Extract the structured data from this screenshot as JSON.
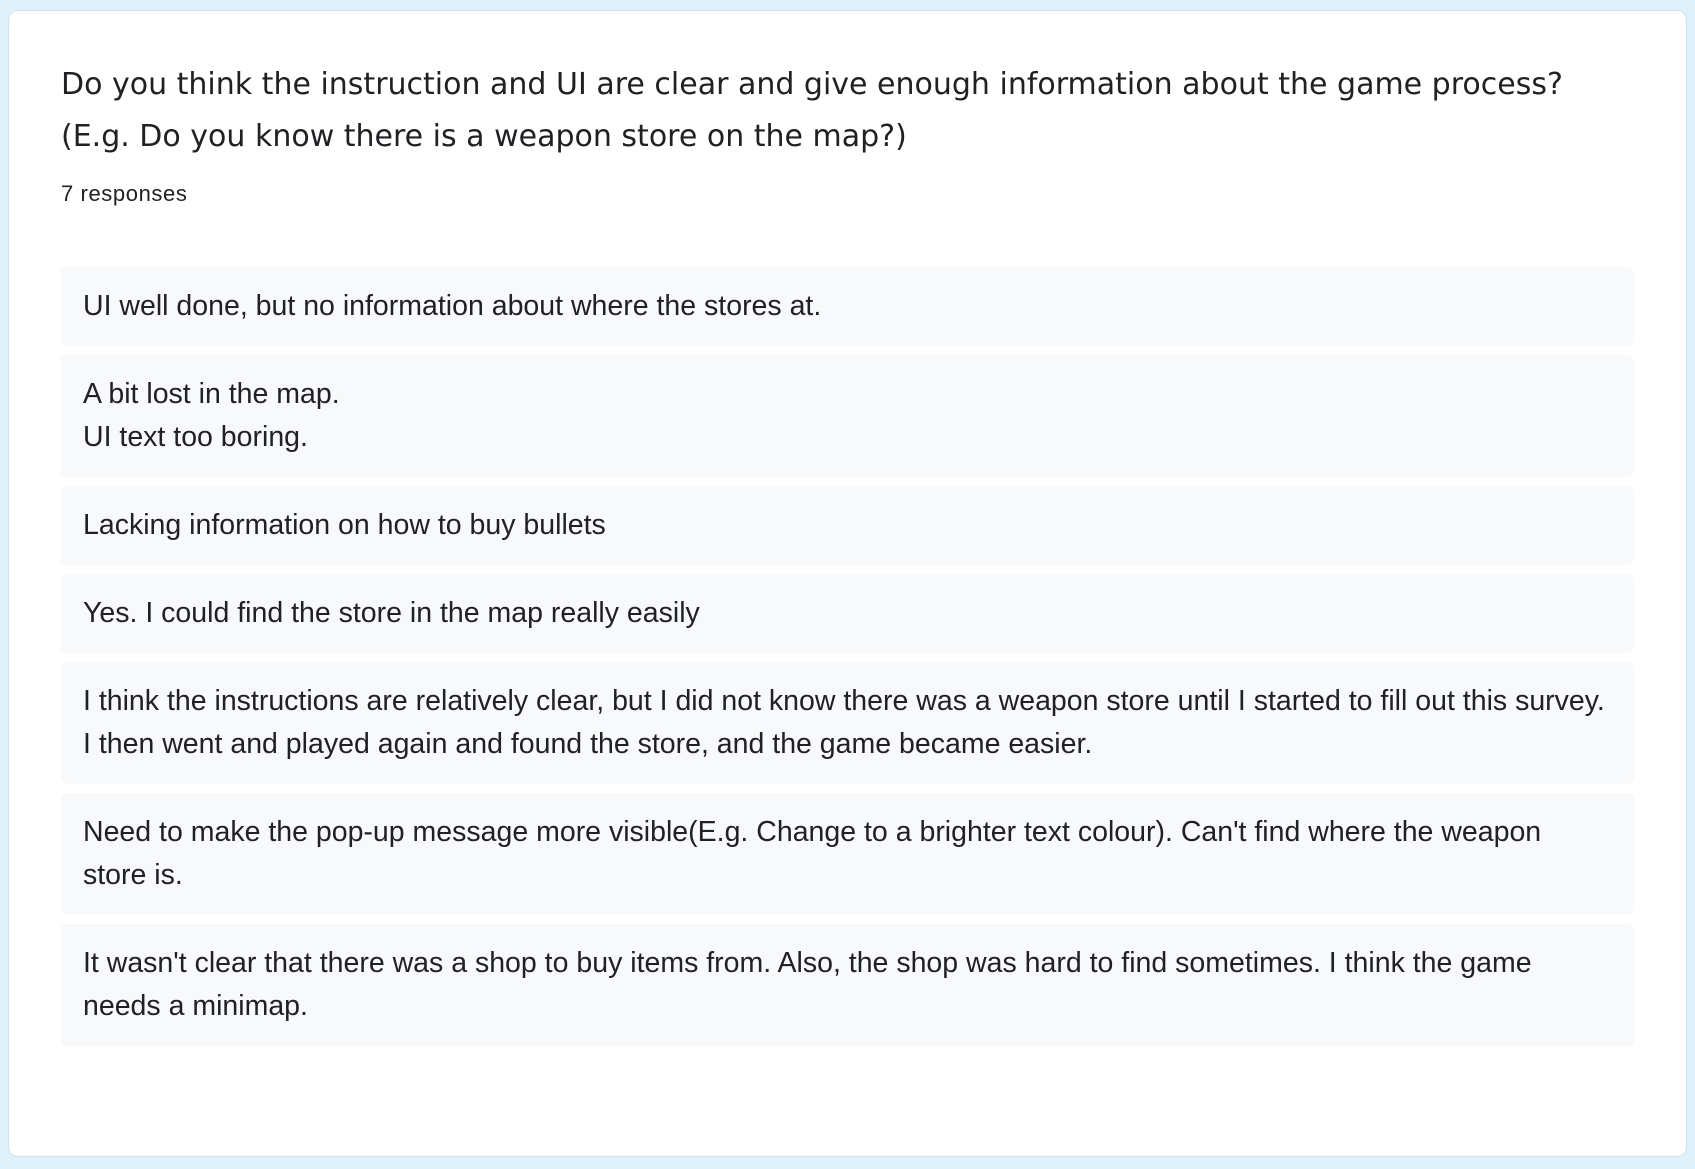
{
  "question": {
    "title": "Do you think the instruction and UI are clear and give enough information about the game process? (E.g. Do you know there is a weapon store on the map?)",
    "response_count": "7 responses"
  },
  "responses": [
    {
      "text": "UI well done, but no information about where the stores at."
    },
    {
      "text": "A bit lost in the map.\nUI text too boring."
    },
    {
      "text": "Lacking information on how to buy bullets"
    },
    {
      "text": "Yes. I could find the store in the map really easily"
    },
    {
      "text": "I think the instructions are relatively clear, but I did not know there was a weapon store until I started to fill out this survey. I then went and played again and found the store, and the game became easier."
    },
    {
      "text": "Need to make the pop-up message more visible(E.g. Change to a brighter text colour). Can't find where the weapon store is."
    },
    {
      "text": "It wasn't clear that there was a shop to buy items from. Also, the shop was hard to find sometimes. I think the game needs a minimap."
    }
  ],
  "colors": {
    "page_background": "#e0f1fb",
    "card_background": "#ffffff",
    "response_background": "#f8f9fa",
    "text": "#202124"
  }
}
